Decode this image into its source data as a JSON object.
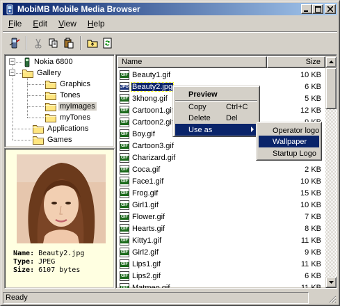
{
  "window": {
    "title": "MobiMB Mobile Media Browser",
    "controls": {
      "minimize": "_",
      "maximize": "□",
      "close": "×"
    }
  },
  "menubar": [
    {
      "label": "File",
      "mnemonic": "F",
      "rest": "ile"
    },
    {
      "label": "Edit",
      "mnemonic": "E",
      "rest": "dit"
    },
    {
      "label": "View",
      "mnemonic": "V",
      "rest": "iew"
    },
    {
      "label": "Help",
      "mnemonic": "H",
      "rest": "elp"
    }
  ],
  "toolbar": {
    "icons": [
      "phone-connect-icon",
      "cut-icon",
      "copy-icon",
      "paste-icon",
      "folder-up-icon",
      "refresh-icon"
    ]
  },
  "tree": {
    "root": "Nokia 6800",
    "items": [
      {
        "label": "Gallery"
      },
      {
        "label": "Graphics"
      },
      {
        "label": "Tones"
      },
      {
        "label": "myImages",
        "selected": true
      },
      {
        "label": "myTones"
      },
      {
        "label": "Applications"
      },
      {
        "label": "Games"
      }
    ]
  },
  "preview": {
    "name_label": "Name:",
    "name_value": "Beauty2.jpg",
    "type_label": "Type:",
    "type_value": "JPEG",
    "size_label": "Size:",
    "size_value": "6107 bytes"
  },
  "list": {
    "columns": {
      "name": "Name",
      "size": "Size"
    },
    "files": [
      {
        "name": "Beauty1.gif",
        "size": "10 KB",
        "type": "gif"
      },
      {
        "name": "Beauty2.jpg",
        "size": "6 KB",
        "type": "jpg",
        "selected": true
      },
      {
        "name": "3khong.gif",
        "size": "5 KB",
        "type": "gif"
      },
      {
        "name": "Cartoon1.gif",
        "size": "12 KB",
        "type": "gif"
      },
      {
        "name": "Cartoon2.gif",
        "size": "9 KB",
        "type": "gif"
      },
      {
        "name": "Boy.gif",
        "size": "",
        "type": "gif"
      },
      {
        "name": "Cartoon3.gif",
        "size": "",
        "type": "gif"
      },
      {
        "name": "Charizard.gif",
        "size": "",
        "type": "gif"
      },
      {
        "name": "Coca.gif",
        "size": "2 KB",
        "type": "gif"
      },
      {
        "name": "Face1.gif",
        "size": "10 KB",
        "type": "gif"
      },
      {
        "name": "Frog.gif",
        "size": "15 KB",
        "type": "gif"
      },
      {
        "name": "Girl1.gif",
        "size": "10 KB",
        "type": "gif"
      },
      {
        "name": "Flower.gif",
        "size": "7 KB",
        "type": "gif"
      },
      {
        "name": "Hearts.gif",
        "size": "8 KB",
        "type": "gif"
      },
      {
        "name": "Kitty1.gif",
        "size": "11 KB",
        "type": "gif"
      },
      {
        "name": "Girl2.gif",
        "size": "9 KB",
        "type": "gif"
      },
      {
        "name": "Lips1.gif",
        "size": "11 KB",
        "type": "gif"
      },
      {
        "name": "Lips2.gif",
        "size": "6 KB",
        "type": "gif"
      },
      {
        "name": "Matmeo.gif",
        "size": "11 KB",
        "type": "gif"
      }
    ],
    "icon_text": {
      "gif": "GIF",
      "jpg": "JPG"
    }
  },
  "context_menu": {
    "items": [
      {
        "label": "Preview",
        "accel": "",
        "bold": true
      },
      {
        "label": "Copy",
        "accel": "Ctrl+C"
      },
      {
        "label": "Delete",
        "accel": "Del"
      },
      {
        "label": "Use as",
        "accel": "",
        "submenu": true,
        "highlighted": true
      }
    ],
    "submenu": [
      {
        "label": "Operator logo"
      },
      {
        "label": "Wallpaper",
        "highlighted": true
      },
      {
        "label": "Startup Logo"
      }
    ]
  },
  "status": {
    "text": "Ready"
  },
  "colors": {
    "selection": "#0a246a",
    "face": "#d4d0c8",
    "tooltip_bg": "#ffffe1",
    "gif_icon": "#1b6b1b",
    "jpg_icon": "#203880"
  }
}
